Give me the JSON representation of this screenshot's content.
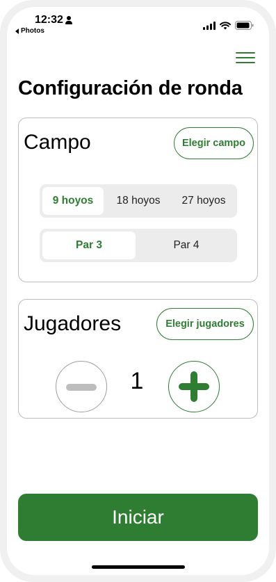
{
  "status_bar": {
    "time": "12:32",
    "back_label": "Photos",
    "icons": [
      "person-icon",
      "signal-icon",
      "wifi-icon",
      "battery-icon"
    ]
  },
  "header": {
    "menu_icon": "hamburger-menu-icon",
    "title": "Configuración de ronda"
  },
  "campo": {
    "title": "Campo",
    "choose_button": "Elegir campo",
    "holes_options": [
      {
        "label": "9 hoyos",
        "selected": true
      },
      {
        "label": "18 hoyos",
        "selected": false
      },
      {
        "label": "27 hoyos",
        "selected": false
      }
    ],
    "par_options": [
      {
        "label": "Par 3",
        "selected": true
      },
      {
        "label": "Par 4",
        "selected": false
      }
    ]
  },
  "jugadores": {
    "title": "Jugadores",
    "choose_button": "Elegir jugadores",
    "count": "1",
    "decrement_icon": "minus-icon",
    "increment_icon": "plus-icon"
  },
  "start_button": "Iniciar",
  "colors": {
    "accent": "#2e7d32",
    "segment_bg": "#ececec",
    "card_border": "#bdbdbd",
    "disabled": "#bdbdbd"
  }
}
